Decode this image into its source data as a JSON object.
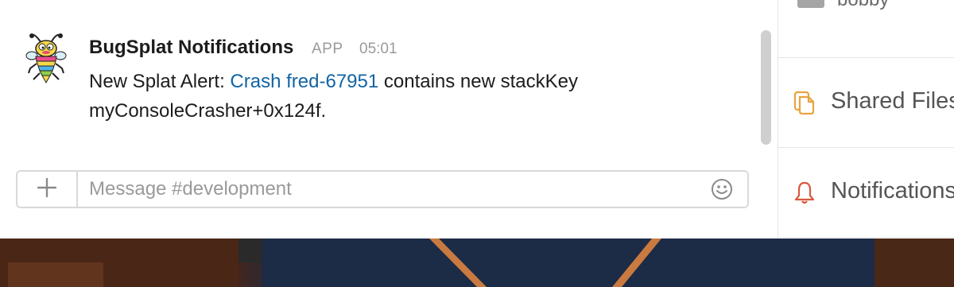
{
  "message": {
    "sender": "BugSplat Notifications",
    "badge": "APP",
    "time": "05:01",
    "text_prefix": "New Splat Alert: ",
    "link_text": "Crash fred-67951",
    "text_suffix": " contains new stackKey myConsoleCrasher+0x124f."
  },
  "composer": {
    "placeholder": "Message #development",
    "add_icon": "plus-icon",
    "emoji_icon": "emoji-icon"
  },
  "sidebar": {
    "user_name": "bobby",
    "items": [
      {
        "label": "Shared Files",
        "icon": "files-icon",
        "color": "#e8a33d"
      },
      {
        "label": "Notifications",
        "icon": "bell-icon",
        "color": "#d9573c"
      }
    ]
  },
  "colors": {
    "link": "#1264a3",
    "text": "#1d1c1d",
    "muted": "#9a9a9a"
  }
}
